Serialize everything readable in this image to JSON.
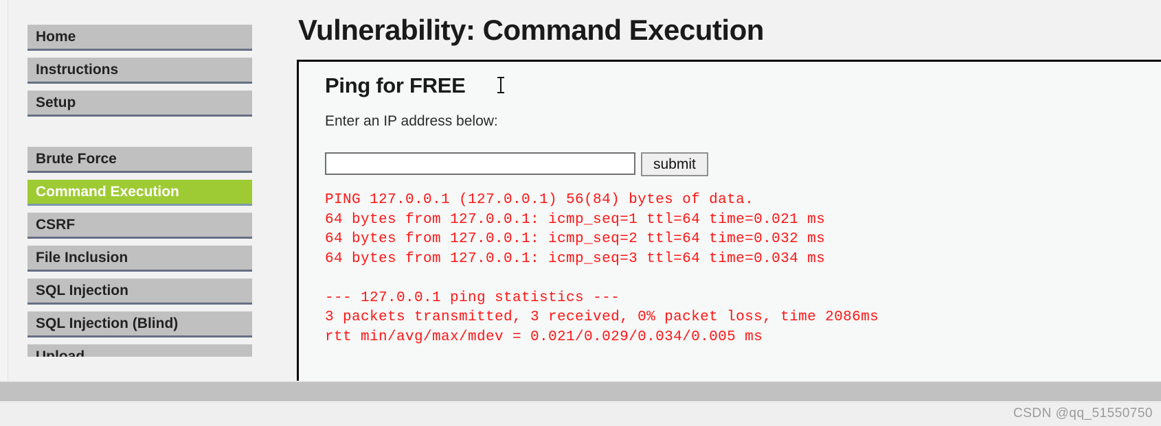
{
  "page": {
    "title": "Vulnerability: Command Execution"
  },
  "sidebar": {
    "primary_items": [
      {
        "label": "Home",
        "active": false
      },
      {
        "label": "Instructions",
        "active": false
      },
      {
        "label": "Setup",
        "active": false
      }
    ],
    "vulnerability_items": [
      {
        "label": "Brute Force",
        "active": false
      },
      {
        "label": "Command Execution",
        "active": true
      },
      {
        "label": "CSRF",
        "active": false
      },
      {
        "label": "File Inclusion",
        "active": false
      },
      {
        "label": "SQL Injection",
        "active": false
      },
      {
        "label": "SQL Injection (Blind)",
        "active": false
      },
      {
        "label": "Upload",
        "active": false
      }
    ]
  },
  "content": {
    "section_title": "Ping for FREE",
    "form_label": "Enter an IP address below:",
    "ip_input_value": "",
    "ip_input_placeholder": "",
    "submit_label": "submit",
    "ping_output": "PING 127.0.0.1 (127.0.0.1) 56(84) bytes of data.\n64 bytes from 127.0.0.1: icmp_seq=1 ttl=64 time=0.021 ms\n64 bytes from 127.0.0.1: icmp_seq=2 ttl=64 time=0.032 ms\n64 bytes from 127.0.0.1: icmp_seq=3 ttl=64 time=0.034 ms\n\n--- 127.0.0.1 ping statistics ---\n3 packets transmitted, 3 received, 0% packet loss, time 2086ms\nrtt min/avg/max/mdev = 0.021/0.029/0.034/0.005 ms"
  },
  "footer": {
    "watermark": "CSDN @qq_51550750"
  },
  "colors": {
    "menu_background": "#c0c0c0",
    "menu_active_background": "#9ecb33",
    "menu_border": "#666f85",
    "output_text": "#ff1515",
    "page_background": "#f2f2f2"
  }
}
